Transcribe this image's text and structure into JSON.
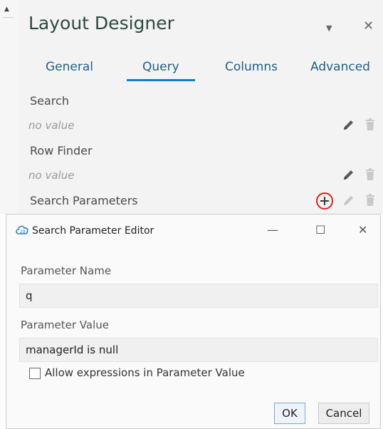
{
  "designer": {
    "title": "Layout Designer",
    "tabs": [
      {
        "label": "General",
        "active": false
      },
      {
        "label": "Query",
        "active": true
      },
      {
        "label": "Columns",
        "active": false
      },
      {
        "label": "Advanced",
        "active": false
      }
    ],
    "search": {
      "label": "Search",
      "value": "no value"
    },
    "row_finder": {
      "label": "Row Finder",
      "value": "no value"
    },
    "search_parameters": {
      "label": "Search Parameters"
    }
  },
  "dialog": {
    "title": "Search Parameter Editor",
    "minimize": "—",
    "maximize": "☐",
    "close": "✕",
    "parameter_name_label": "Parameter Name",
    "parameter_name_value": "q",
    "parameter_value_label": "Parameter Value",
    "parameter_value_value": "managerId is null",
    "allow_expressions_label": "Allow expressions in Parameter Value",
    "allow_expressions_checked": false,
    "ok_label": "OK",
    "cancel_label": "Cancel"
  },
  "colors": {
    "accent": "#1979bd",
    "tab_text": "#1f5f86",
    "title_text": "#2e4a40",
    "highlight_circle": "#e02020"
  }
}
